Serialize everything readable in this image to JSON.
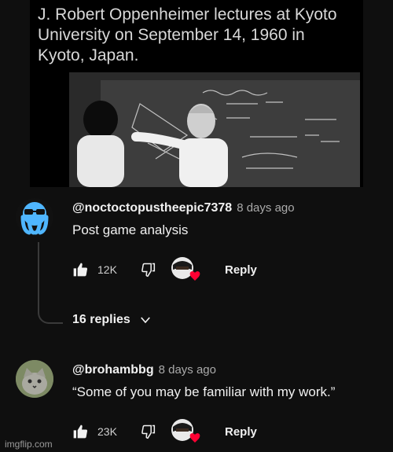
{
  "post": {
    "caption": "J. Robert Oppenheimer lectures at Kyoto University on September 14, 1960 in Kyoto, Japan."
  },
  "comments": [
    {
      "handle": "@noctoctopustheepic7378",
      "time": "8 days ago",
      "text": "Post game analysis",
      "likes": "12K",
      "reply_label": "Reply",
      "avatar_icon": "blue-octopus-avatar-icon"
    },
    {
      "handle": "@brohambbg",
      "time": "8 days ago",
      "text": "“Some of you may be familiar with my work.”",
      "likes": "23K",
      "reply_label": "Reply",
      "avatar_icon": "cat-avatar-icon"
    }
  ],
  "replies_toggle": {
    "label": "16 replies"
  },
  "watermark": "imgflip.com",
  "colors": {
    "background": "#0f0f0f",
    "text_primary": "#f1f1f1",
    "text_secondary": "#aaaaaa",
    "heart": "#ff0033",
    "avatar_blue": "#4fb6ff"
  }
}
